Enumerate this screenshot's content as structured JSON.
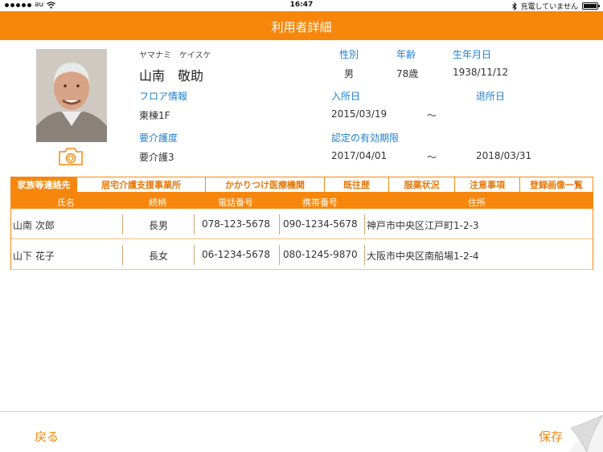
{
  "status_bar": {
    "carrier": "au",
    "time": "16:47",
    "charging_text": "充電していません"
  },
  "nav": {
    "title": "利用者詳細"
  },
  "profile": {
    "kana": "ヤマナミ　ケイスケ",
    "name": "山南　敬助",
    "gender_label": "性別",
    "gender": "男",
    "age_label": "年齢",
    "age": "78歳",
    "birth_label": "生年月日",
    "birth": "1938/11/12",
    "floor_label": "フロア情報",
    "floor": "東棟1F",
    "admission_label": "入所日",
    "admission": "2015/03/19",
    "admission_sep": "〜",
    "discharge_label": "退所日",
    "care_label": "要介護度",
    "care": "要介護3",
    "validity_label": "認定の有効期限",
    "validity_start": "2017/04/01",
    "validity_sep": "〜",
    "validity_end": "2018/03/31"
  },
  "tabs": [
    {
      "label": "家族等連絡先",
      "active": true
    },
    {
      "label": "居宅介護支援事業所",
      "active": false
    },
    {
      "label": "かかりつけ医療機関",
      "active": false
    },
    {
      "label": "既往歴",
      "active": false
    },
    {
      "label": "服薬状況",
      "active": false
    },
    {
      "label": "注意事項",
      "active": false
    },
    {
      "label": "登録画像一覧",
      "active": false
    }
  ],
  "table": {
    "headers": [
      "氏名",
      "続柄",
      "電話番号",
      "携帯番号",
      "住所"
    ],
    "rows": [
      [
        "山南 次郎",
        "長男",
        "078-123-5678",
        "090-1234-5678",
        "神戸市中央区江戸町1-2-3"
      ],
      [
        "山下 花子",
        "長女",
        "06-1234-5678",
        "080-1245-9870",
        "大阪市中央区南船場1-2-4"
      ]
    ]
  },
  "bottom": {
    "back_label": "戻る",
    "save_label": "保存"
  },
  "colors": {
    "accent": "#f7870c",
    "label_blue": "#1e7fd0"
  },
  "icons": [
    "signal-dots-icon",
    "wifi-icon",
    "bluetooth-icon",
    "battery-icon",
    "camera-icon",
    "page-curl-icon"
  ]
}
